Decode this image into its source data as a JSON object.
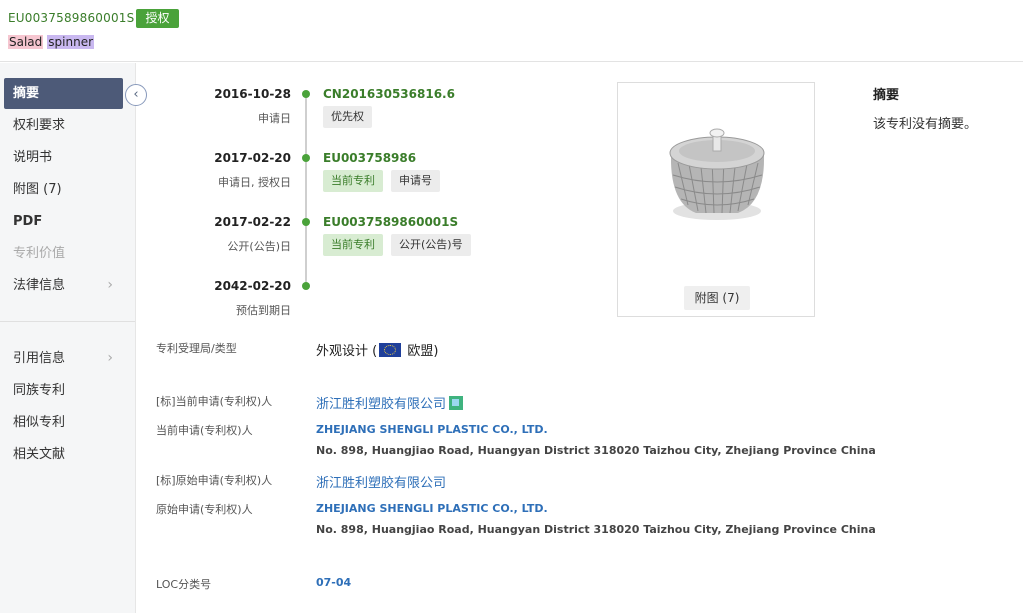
{
  "header": {
    "patent_number": "EU003758986000 1S",
    "status_badge": "授权",
    "title_word1": "Salad",
    "title_word2": "spinner"
  },
  "sidebar": {
    "items": [
      {
        "label": "摘要",
        "state": "active"
      },
      {
        "label": "权利要求",
        "state": "normal"
      },
      {
        "label": "说明书",
        "state": "normal"
      },
      {
        "label": "附图 (7)",
        "state": "normal"
      },
      {
        "label": "PDF",
        "state": "normal"
      },
      {
        "label": "专利价值",
        "state": "disabled"
      },
      {
        "label": "法律信息",
        "state": "normal",
        "chevron": "›"
      },
      {
        "label": "引用信息",
        "state": "normal",
        "chevron": "›"
      },
      {
        "label": "同族专利",
        "state": "normal"
      },
      {
        "label": "相似专利",
        "state": "normal"
      },
      {
        "label": "相关文献",
        "state": "normal"
      }
    ],
    "collapse_icon": "‹"
  },
  "timeline": [
    {
      "date": "2016-10-28",
      "sub": "申请日",
      "number": "CN201630536816.6",
      "tags": [
        {
          "text": "优先权",
          "style": "gray"
        }
      ]
    },
    {
      "date": "2017-02-20",
      "sub": "申请日, 授权日",
      "number": "EU003758986",
      "tags": [
        {
          "text": "当前专利",
          "style": "green"
        },
        {
          "text": "申请号",
          "style": "gray"
        }
      ]
    },
    {
      "date": "2017-02-22",
      "sub": "公开(公告)日",
      "number": "EU0037589860001S",
      "tags": [
        {
          "text": "当前专利",
          "style": "green"
        },
        {
          "text": "公开(公告)号",
          "style": "gray"
        }
      ]
    },
    {
      "date": "2042-02-20",
      "sub": "预估到期日",
      "number": "",
      "tags": []
    }
  ],
  "figure": {
    "button_label": "附图 (7)"
  },
  "abstract": {
    "title": "摘要",
    "text": "该专利没有摘要。"
  },
  "details": {
    "office_label": "专利受理局/类型",
    "office_value_prefix": "外观设计 (",
    "office_value_suffix": " 欧盟)",
    "std_current_label": "[标]当前申请(专利权)人",
    "std_current_value": "浙江胜利塑胶有限公司",
    "current_label": "当前申请(专利权)人",
    "current_name": "ZHEJIANG SHENGLI PLASTIC CO., LTD.",
    "current_addr": "No. 898, Huangjiao Road, Huangyan District 318020 Taizhou City, Zhejiang Province China",
    "std_orig_label": "[标]原始申请(专利权)人",
    "std_orig_value": "浙江胜利塑胶有限公司",
    "orig_label": "原始申请(专利权)人",
    "orig_name": "ZHEJIANG SHENGLI PLASTIC CO., LTD.",
    "orig_addr": "No. 898, Huangjiao Road, Huangyan District 318020 Taizhou City, Zhejiang Province China",
    "loc_label": "LOC分类号",
    "loc_value": "07-04"
  },
  "colors": {
    "accent_green": "#4aa23a",
    "nav_active": "#4d5a78",
    "link_blue": "#2e6fb8"
  }
}
